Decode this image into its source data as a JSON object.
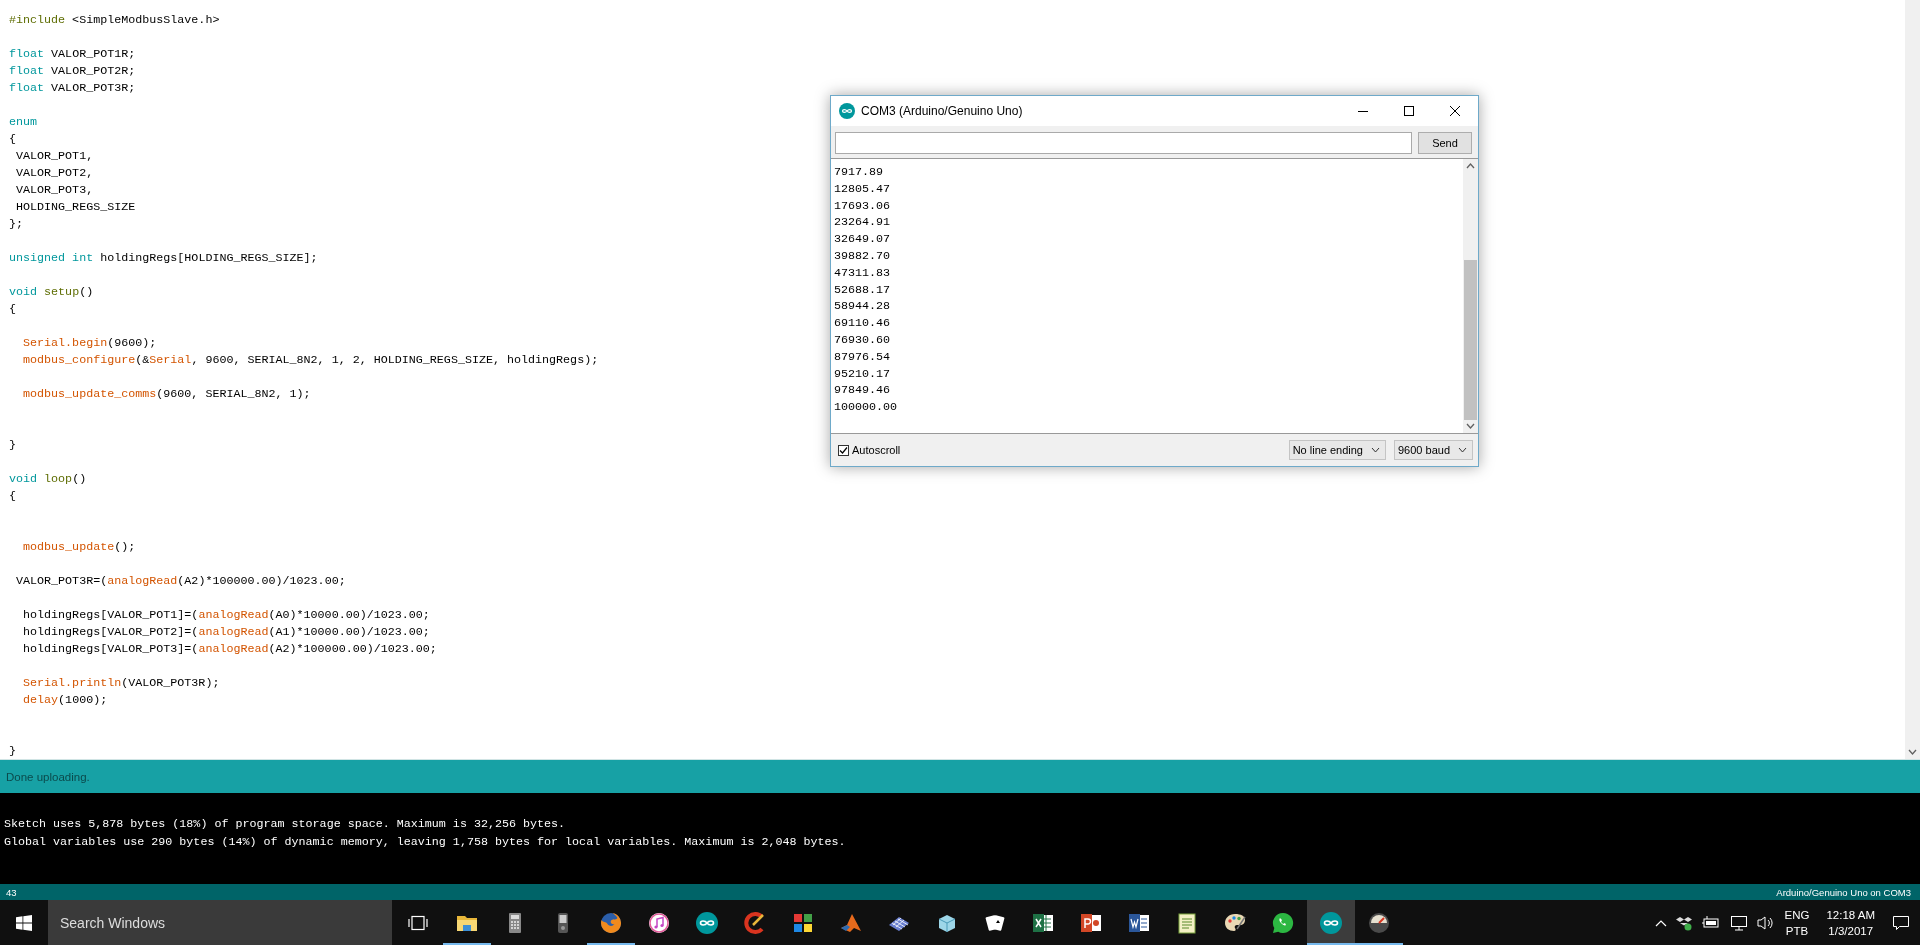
{
  "editor": {
    "lines": [
      {
        "kind": "code",
        "tokens": [
          {
            "kind": "structure",
            "text": "#include"
          },
          {
            "kind": "plain",
            "text": " <SimpleModbusSlave.h>"
          }
        ]
      },
      {
        "kind": "blank"
      },
      {
        "kind": "code",
        "tokens": [
          {
            "kind": "keyword",
            "text": "float"
          },
          {
            "kind": "plain",
            "text": " VALOR_POT1R;"
          }
        ]
      },
      {
        "kind": "code",
        "tokens": [
          {
            "kind": "keyword",
            "text": "float"
          },
          {
            "kind": "plain",
            "text": " VALOR_POT2R;"
          }
        ]
      },
      {
        "kind": "code",
        "tokens": [
          {
            "kind": "keyword",
            "text": "float"
          },
          {
            "kind": "plain",
            "text": " VALOR_POT3R;"
          }
        ]
      },
      {
        "kind": "blank"
      },
      {
        "kind": "code",
        "tokens": [
          {
            "kind": "keyword",
            "text": "enum"
          }
        ]
      },
      {
        "kind": "code",
        "tokens": [
          {
            "kind": "plain",
            "text": "{"
          }
        ]
      },
      {
        "kind": "code",
        "tokens": [
          {
            "kind": "plain",
            "text": " VALOR_POT1,"
          }
        ]
      },
      {
        "kind": "code",
        "tokens": [
          {
            "kind": "plain",
            "text": " VALOR_POT2,"
          }
        ]
      },
      {
        "kind": "code",
        "tokens": [
          {
            "kind": "plain",
            "text": " VALOR_POT3,"
          }
        ]
      },
      {
        "kind": "code",
        "tokens": [
          {
            "kind": "plain",
            "text": " HOLDING_REGS_SIZE"
          }
        ]
      },
      {
        "kind": "code",
        "tokens": [
          {
            "kind": "plain",
            "text": "};"
          }
        ]
      },
      {
        "kind": "blank"
      },
      {
        "kind": "code",
        "tokens": [
          {
            "kind": "keyword",
            "text": "unsigned"
          },
          {
            "kind": "keyword",
            "text": " int"
          },
          {
            "kind": "plain",
            "text": " holdingRegs[HOLDING_REGS_SIZE];"
          }
        ]
      },
      {
        "kind": "blank"
      },
      {
        "kind": "code",
        "tokens": [
          {
            "kind": "keyword",
            "text": "void"
          },
          {
            "kind": "structure",
            "text": " setup"
          },
          {
            "kind": "plain",
            "text": "()"
          }
        ]
      },
      {
        "kind": "code",
        "tokens": [
          {
            "kind": "plain",
            "text": "{"
          }
        ]
      },
      {
        "kind": "blank"
      },
      {
        "kind": "code",
        "tokens": [
          {
            "kind": "function",
            "text": "  Serial.begin"
          },
          {
            "kind": "plain",
            "text": "(9600);"
          }
        ]
      },
      {
        "kind": "code",
        "tokens": [
          {
            "kind": "function",
            "text": "  modbus_configure"
          },
          {
            "kind": "plain",
            "text": "(&"
          },
          {
            "kind": "function",
            "text": "Serial"
          },
          {
            "kind": "plain",
            "text": ", 9600, SERIAL_8N2, 1, 2, HOLDING_REGS_SIZE, holdingRegs);"
          }
        ]
      },
      {
        "kind": "blank"
      },
      {
        "kind": "code",
        "tokens": [
          {
            "kind": "function",
            "text": "  modbus_update_comms"
          },
          {
            "kind": "plain",
            "text": "(9600, SERIAL_8N2, 1);"
          }
        ]
      },
      {
        "kind": "blank"
      },
      {
        "kind": "blank"
      },
      {
        "kind": "code",
        "tokens": [
          {
            "kind": "plain",
            "text": "}"
          }
        ]
      },
      {
        "kind": "blank"
      },
      {
        "kind": "code",
        "tokens": [
          {
            "kind": "keyword",
            "text": "void"
          },
          {
            "kind": "structure",
            "text": " loop"
          },
          {
            "kind": "plain",
            "text": "()"
          }
        ]
      },
      {
        "kind": "code",
        "tokens": [
          {
            "kind": "plain",
            "text": "{"
          }
        ]
      },
      {
        "kind": "blank"
      },
      {
        "kind": "blank"
      },
      {
        "kind": "code",
        "tokens": [
          {
            "kind": "function",
            "text": "  modbus_update"
          },
          {
            "kind": "plain",
            "text": "();"
          }
        ]
      },
      {
        "kind": "blank"
      },
      {
        "kind": "code",
        "tokens": [
          {
            "kind": "plain",
            "text": " VALOR_POT3R=("
          },
          {
            "kind": "function",
            "text": "analogRead"
          },
          {
            "kind": "plain",
            "text": "(A2)*100000.00)/1023.00;"
          }
        ]
      },
      {
        "kind": "blank"
      },
      {
        "kind": "code",
        "tokens": [
          {
            "kind": "plain",
            "text": "  holdingRegs[VALOR_POT1]=("
          },
          {
            "kind": "function",
            "text": "analogRead"
          },
          {
            "kind": "plain",
            "text": "(A0)*10000.00)/1023.00;"
          }
        ]
      },
      {
        "kind": "code",
        "tokens": [
          {
            "kind": "plain",
            "text": "  holdingRegs[VALOR_POT2]=("
          },
          {
            "kind": "function",
            "text": "analogRead"
          },
          {
            "kind": "plain",
            "text": "(A1)*10000.00)/1023.00;"
          }
        ]
      },
      {
        "kind": "code",
        "tokens": [
          {
            "kind": "plain",
            "text": "  holdingRegs[VALOR_POT3]=("
          },
          {
            "kind": "function",
            "text": "analogRead"
          },
          {
            "kind": "plain",
            "text": "(A2)*100000.00)/1023.00;"
          }
        ]
      },
      {
        "kind": "blank"
      },
      {
        "kind": "code",
        "tokens": [
          {
            "kind": "function",
            "text": "  Serial.println"
          },
          {
            "kind": "plain",
            "text": "(VALOR_POT3R);"
          }
        ]
      },
      {
        "kind": "code",
        "tokens": [
          {
            "kind": "function",
            "text": "  delay"
          },
          {
            "kind": "plain",
            "text": "(1000);"
          }
        ]
      },
      {
        "kind": "blank"
      },
      {
        "kind": "blank"
      },
      {
        "kind": "code",
        "tokens": [
          {
            "kind": "plain",
            "text": "}"
          }
        ]
      }
    ],
    "status": "Done uploading.",
    "console": [
      "Sketch uses 5,878 bytes (18%) of program storage space. Maximum is 32,256 bytes.",
      "Global variables use 290 bytes (14%) of dynamic memory, leaving 1,758 bytes for local variables. Maximum is 2,048 bytes."
    ],
    "line_number": "43",
    "board": "Arduino/Genuino Uno on COM3"
  },
  "serial_monitor": {
    "title": "COM3 (Arduino/Genuino Uno)",
    "send_button": "Send",
    "output": [
      "7917.89",
      "12805.47",
      "17693.06",
      "23264.91",
      "32649.07",
      "39882.70",
      "47311.83",
      "52688.17",
      "58944.28",
      "69110.46",
      "76930.60",
      "87976.54",
      "95210.17",
      "97849.46",
      "100000.00"
    ],
    "autoscroll": {
      "label": "Autoscroll",
      "checked": true
    },
    "line_ending": "No line ending",
    "baud": "9600 baud"
  },
  "taskbar": {
    "search_placeholder": "Search Windows",
    "apps": [
      {
        "kind": "folder",
        "running": true,
        "selected": false
      },
      {
        "kind": "calculator",
        "running": false,
        "selected": false
      },
      {
        "kind": "phone",
        "running": false,
        "selected": false
      },
      {
        "kind": "browser",
        "running": true,
        "selected": false
      },
      {
        "kind": "music",
        "running": false,
        "selected": false
      },
      {
        "kind": "infinity",
        "running": false,
        "selected": false
      },
      {
        "kind": "brush",
        "running": false,
        "selected": false
      },
      {
        "kind": "tiles",
        "running": false,
        "selected": false
      },
      {
        "kind": "peak",
        "running": false,
        "selected": false
      },
      {
        "kind": "plane",
        "running": false,
        "selected": false
      },
      {
        "kind": "cube",
        "running": false,
        "selected": false
      },
      {
        "kind": "cards",
        "running": false,
        "selected": false
      },
      {
        "kind": "spreadsheet",
        "running": false,
        "selected": false
      },
      {
        "kind": "slides",
        "running": false,
        "selected": false
      },
      {
        "kind": "document",
        "running": false,
        "selected": false
      },
      {
        "kind": "notepad",
        "running": false,
        "selected": false
      },
      {
        "kind": "palette",
        "running": false,
        "selected": false
      },
      {
        "kind": "chat",
        "running": false,
        "selected": false
      },
      {
        "kind": "infinity",
        "running": true,
        "selected": true
      },
      {
        "kind": "gauge",
        "running": true,
        "selected": false
      }
    ],
    "language": [
      "ENG",
      "PTB"
    ],
    "time": "12:18 AM",
    "date": "1/3/2017"
  }
}
